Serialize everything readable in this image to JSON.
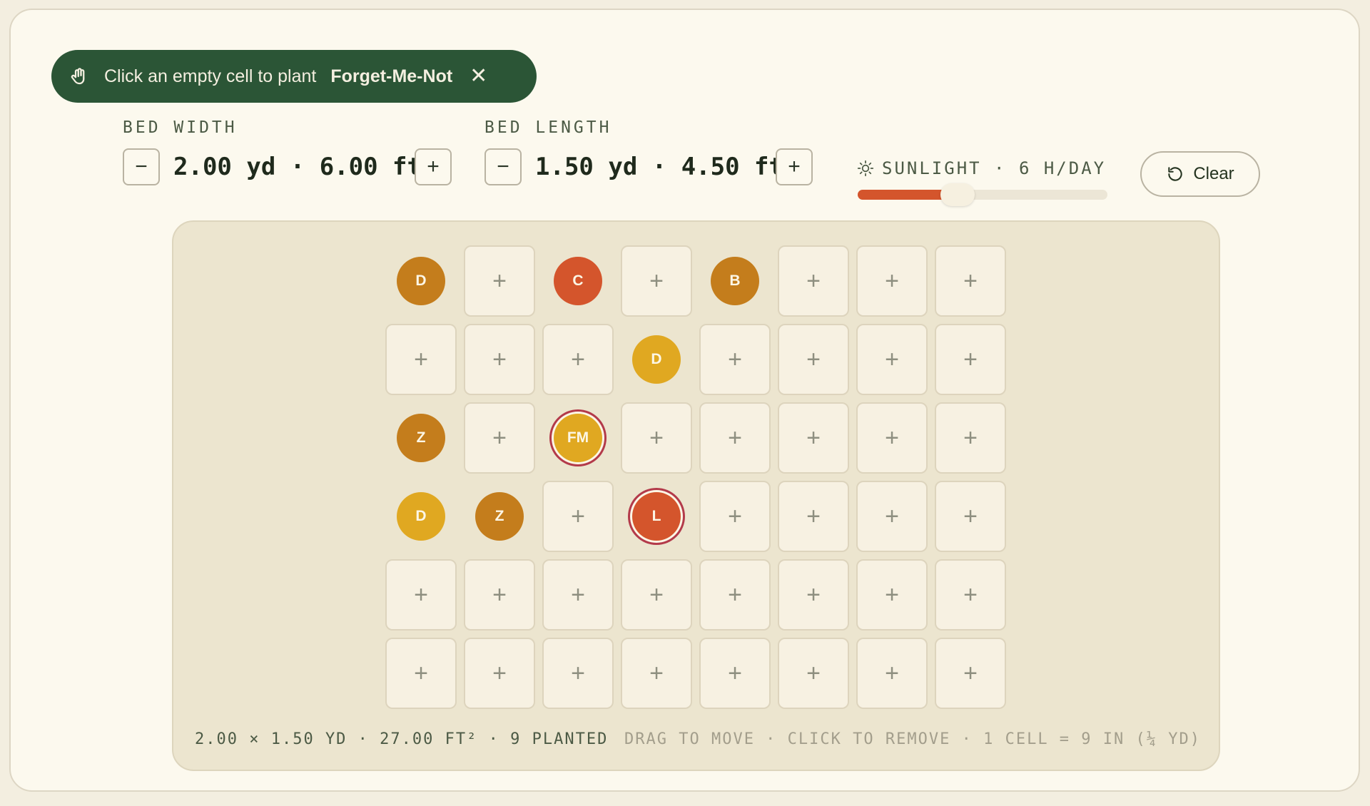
{
  "toast": {
    "message": "Click an empty cell to plant",
    "plant_name": "Forget-Me-Not",
    "close_glyph": "✕",
    "icon": "hand-icon"
  },
  "bed_width": {
    "label": "BED WIDTH",
    "value": "2.00 yd · 6.00 ft",
    "decrement": "−",
    "increment": "+"
  },
  "bed_length": {
    "label": "BED LENGTH",
    "value": "1.50 yd · 4.50 ft",
    "decrement": "−",
    "increment": "+"
  },
  "sunlight": {
    "label": "SUNLIGHT · 6 H/DAY",
    "hours": 6,
    "max_hours": 15,
    "icon": "sun-icon"
  },
  "clear_button": {
    "label": "Clear",
    "icon": "reset-icon"
  },
  "colors": {
    "amber": "#c47d1c",
    "orange_red": "#d4552c",
    "yellow": "#e0a821",
    "toast_green": "#2b5536",
    "ring": "#b33a4a"
  },
  "grid": {
    "columns": 8,
    "empty_glyph": "+",
    "rows": [
      [
        {
          "code": "D",
          "color": "amber"
        },
        null,
        {
          "code": "C",
          "color": "orange_red"
        },
        null,
        {
          "code": "B",
          "color": "amber"
        },
        null,
        null,
        null
      ],
      [
        null,
        null,
        null,
        {
          "code": "D",
          "color": "yellow"
        },
        null,
        null,
        null,
        null
      ],
      [
        {
          "code": "Z",
          "color": "amber"
        },
        null,
        {
          "code": "FM",
          "color": "yellow",
          "ring": true
        },
        null,
        null,
        null,
        null,
        null
      ],
      [
        {
          "code": "D",
          "color": "yellow"
        },
        {
          "code": "Z",
          "color": "amber"
        },
        null,
        {
          "code": "L",
          "color": "orange_red",
          "ring": true
        },
        null,
        null,
        null,
        null
      ],
      [
        null,
        null,
        null,
        null,
        null,
        null,
        null,
        null
      ],
      [
        null,
        null,
        null,
        null,
        null,
        null,
        null,
        null
      ]
    ]
  },
  "footer": {
    "stats": "2.00 × 1.50 YD · 27.00 FT² · 9 PLANTED",
    "hint": "DRAG TO MOVE · CLICK TO REMOVE · 1 CELL = 9 IN (¼ YD)"
  }
}
